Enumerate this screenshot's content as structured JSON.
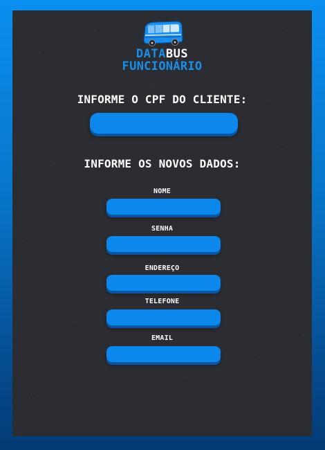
{
  "logo": {
    "icon": "bus-icon",
    "word_data": "DATA",
    "word_bus": "BUS",
    "subtitle": "FUNCIONÁRIO"
  },
  "cpf_section": {
    "heading": "INFORME O CPF DO CLIENTE:",
    "input_value": "",
    "input_placeholder": ""
  },
  "new_data_section": {
    "heading": "INFORME OS NOVOS DADOS:",
    "fields": [
      {
        "label": "NOME",
        "value": ""
      },
      {
        "label": "SENHA",
        "value": ""
      },
      {
        "label": "ENDEREÇO",
        "value": ""
      },
      {
        "label": "TELEFONE",
        "value": ""
      },
      {
        "label": "EMAIL",
        "value": ""
      }
    ]
  },
  "colors": {
    "page_gradient_top": "#0a8ff0",
    "page_gradient_bottom": "#043b75",
    "panel": "#2c2c33",
    "input": "#0c87ec",
    "input_shadow": "#0a56a3",
    "brand_blue": "#1a8fe8",
    "text": "#ffffff"
  }
}
